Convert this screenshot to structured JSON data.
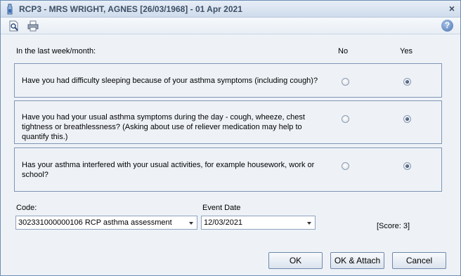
{
  "window": {
    "title": "RCP3 - MRS WRIGHT, AGNES [26/03/1968] - 01 Apr 2021",
    "close_label": "×",
    "icons": [
      "app-icon",
      "preview-icon",
      "print-icon",
      "help-icon"
    ],
    "help_label": "?"
  },
  "form": {
    "intro": "In the last week/month:",
    "col_no": "No",
    "col_yes": "Yes",
    "questions": [
      {
        "text": "Have you had difficulty sleeping because of your asthma symptoms (including cough)?",
        "answer": "Yes"
      },
      {
        "text": "Have you had your usual asthma symptoms during the day - cough, wheeze, chest tightness or breathlessness? (Asking about use of reliever medication may help to quantify this.)",
        "answer": "Yes"
      },
      {
        "text": "Has your asthma interfered with your usual activities, for example housework, work or school?",
        "answer": "Yes"
      }
    ],
    "code_label": "Code:",
    "code_value": "302331000000106 RCP asthma assessment",
    "event_date_label": "Event Date",
    "event_date_value": "12/03/2021",
    "score": "[Score: 3]"
  },
  "buttons": {
    "ok": "OK",
    "ok_attach": "OK & Attach",
    "cancel": "Cancel"
  },
  "colors": {
    "title_text": "#3d4f66",
    "border": "#7f95b5",
    "background": "#eef2f7"
  }
}
